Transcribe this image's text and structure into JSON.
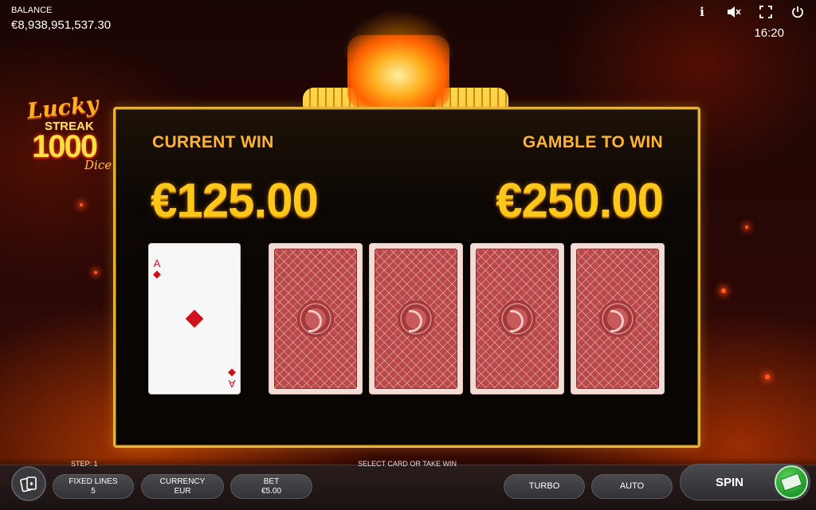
{
  "header": {
    "balance_label": "BALANCE",
    "balance_value": "€8,938,951,537.30",
    "clock": "16:20",
    "icons": [
      "info-icon",
      "mute-icon",
      "fullscreen-icon",
      "power-icon"
    ]
  },
  "logo": {
    "line1": "Lucky",
    "line2": "STREAK",
    "line3": "1000",
    "line4": "Dice"
  },
  "gamble": {
    "current_win_label": "CURRENT WIN",
    "current_win_value": "€125.00",
    "gamble_label": "GAMBLE TO WIN",
    "gamble_value": "€250.00",
    "dealer_card": {
      "rank": "A",
      "suit": "diamonds"
    },
    "face_down_cards": 4
  },
  "bottom": {
    "step": "STEP: 1",
    "status": "SELECT CARD OR TAKE WIN",
    "fixed_lines_label": "FIXED LINES",
    "fixed_lines_value": "5",
    "currency_label": "CURRENCY",
    "currency_value": "EUR",
    "bet_label": "BET",
    "bet_value": "€5.00",
    "turbo_label": "TURBO",
    "auto_label": "AUTO",
    "spin_label": "SPIN"
  },
  "colors": {
    "gold": "#ffc71a",
    "panel_border": "#e2b23a",
    "card_back": "#b9484a",
    "suit_red": "#d0101a",
    "spin_green": "#1e9a2a"
  }
}
